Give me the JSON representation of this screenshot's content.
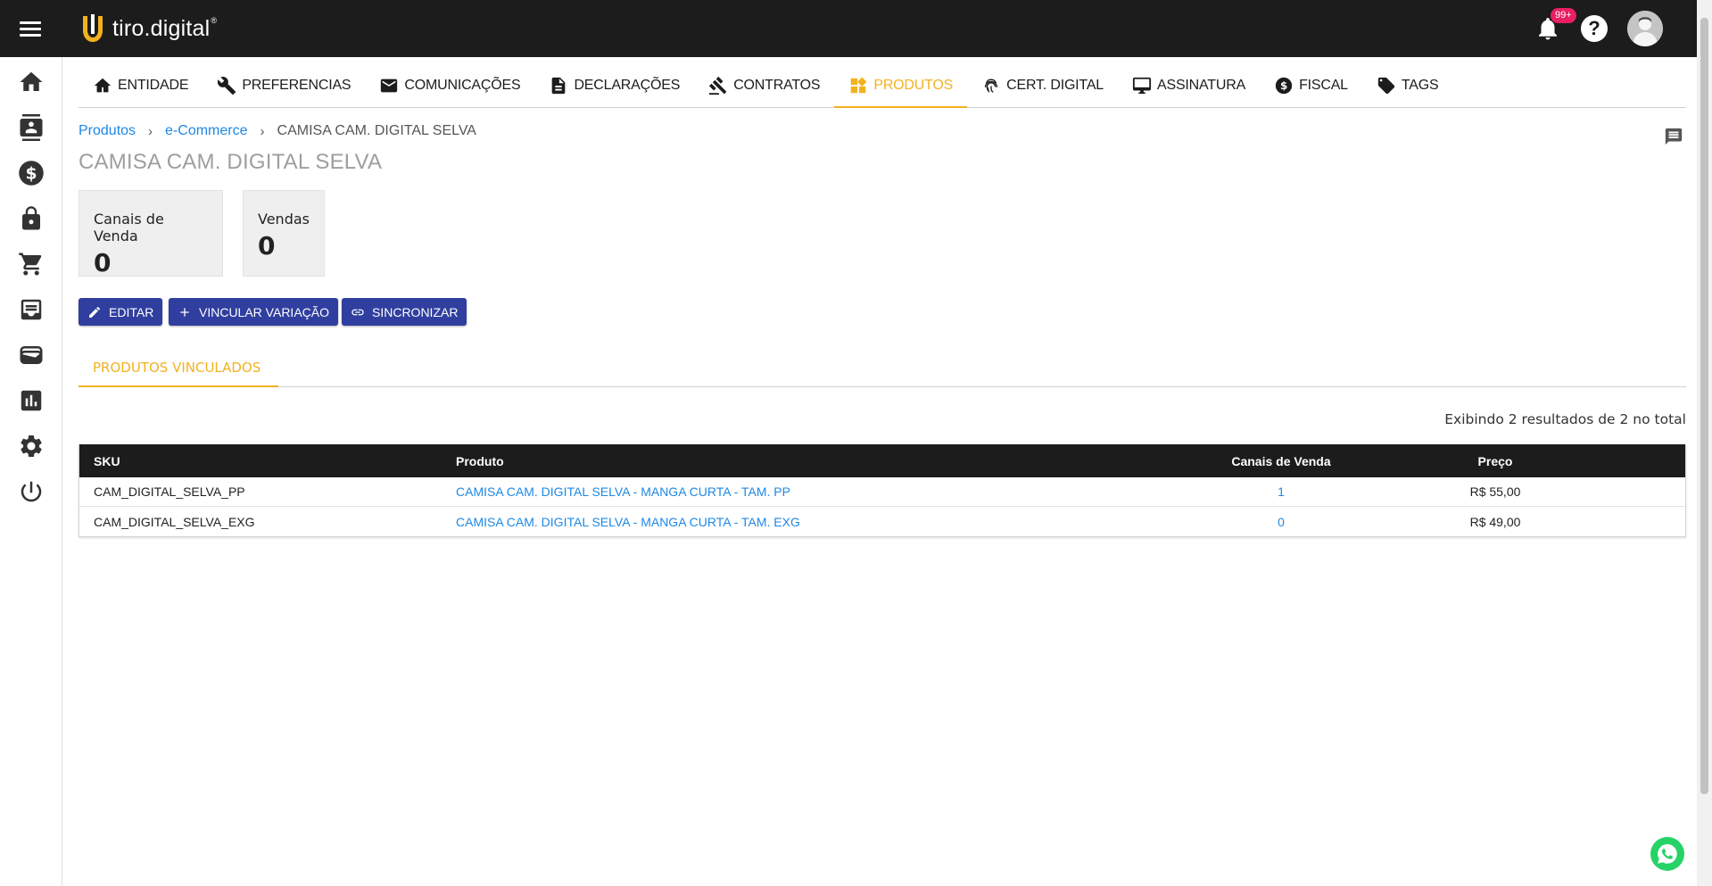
{
  "header": {
    "logo_text": "tiro.digital",
    "logo_mark": "®",
    "notifications_badge": "99+",
    "help_label": "?"
  },
  "sidebar": {
    "items": [
      {
        "icon": "home-icon"
      },
      {
        "icon": "contacts-icon"
      },
      {
        "icon": "dollar-icon"
      },
      {
        "icon": "lock-icon"
      },
      {
        "icon": "cart-icon"
      },
      {
        "icon": "inbox-icon"
      },
      {
        "icon": "wallet-icon"
      },
      {
        "icon": "chart-icon"
      },
      {
        "icon": "gear-icon"
      },
      {
        "icon": "power-icon"
      }
    ]
  },
  "nav": {
    "tabs": [
      {
        "label": "ENTIDADE"
      },
      {
        "label": "PREFERENCIAS"
      },
      {
        "label": "COMUNICAÇÕES"
      },
      {
        "label": "DECLARAÇÕES"
      },
      {
        "label": "CONTRATOS"
      },
      {
        "label": "PRODUTOS"
      },
      {
        "label": "CERT. DIGITAL"
      },
      {
        "label": "ASSINATURA"
      },
      {
        "label": "FISCAL"
      },
      {
        "label": "TAGS"
      }
    ],
    "active": "PRODUTOS"
  },
  "breadcrumb": {
    "items": [
      "Produtos",
      "e-Commerce"
    ],
    "separator": "›",
    "current": "CAMISA CAM. DIGITAL SELVA"
  },
  "page": {
    "title": "CAMISA CAM. DIGITAL SELVA"
  },
  "stats": [
    {
      "label": "Canais de Venda",
      "value": "0"
    },
    {
      "label": "Vendas",
      "value": "0"
    }
  ],
  "actions": {
    "edit": "EDITAR",
    "link_variation": "VINCULAR VARIAÇÃO",
    "sync": "SINCRONIZAR"
  },
  "inner_tabs": {
    "linked_products": "PRODUTOS VINCULADOS"
  },
  "results_text": "Exibindo 2 resultados de 2 no total",
  "table": {
    "headers": {
      "sku": "SKU",
      "produto": "Produto",
      "canais": "Canais de Venda",
      "preco": "Preço"
    },
    "rows": [
      {
        "sku": "CAM_DIGITAL_SELVA_PP",
        "produto": "CAMISA CAM. DIGITAL SELVA - MANGA CURTA - TAM. PP",
        "canais": "1",
        "preco": "R$ 55,00"
      },
      {
        "sku": "CAM_DIGITAL_SELVA_EXG",
        "produto": "CAMISA CAM. DIGITAL SELVA - MANGA CURTA - TAM. EXG",
        "canais": "0",
        "preco": "R$ 49,00"
      }
    ]
  },
  "colors": {
    "accent": "#f2b21f",
    "primary_button": "#303f9f",
    "link": "#1e88e5",
    "topbar": "#1c1c1c",
    "badge": "#e91e63"
  }
}
